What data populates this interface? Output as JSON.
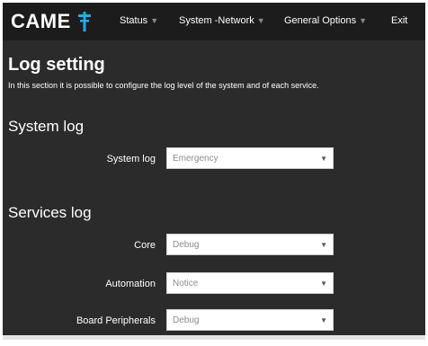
{
  "header": {
    "logo_text": "CAME",
    "nav": [
      {
        "label": "Status"
      },
      {
        "label": "System -Network"
      },
      {
        "label": "General Options"
      },
      {
        "label": "Exit"
      }
    ],
    "colors": {
      "accent": "#2aa9e0",
      "bar": "#1c1c1c"
    }
  },
  "page": {
    "title": "Log setting",
    "description": "In this section it is possible to configure the log level of the system and of each service."
  },
  "system_log": {
    "heading": "System log",
    "label": "System log",
    "value": "Emergency"
  },
  "services_log": {
    "heading": "Services log",
    "rows": [
      {
        "label": "Core",
        "value": "Debug"
      },
      {
        "label": "Automation",
        "value": "Notice"
      },
      {
        "label": "Board Peripherals",
        "value": "Debug"
      }
    ]
  }
}
